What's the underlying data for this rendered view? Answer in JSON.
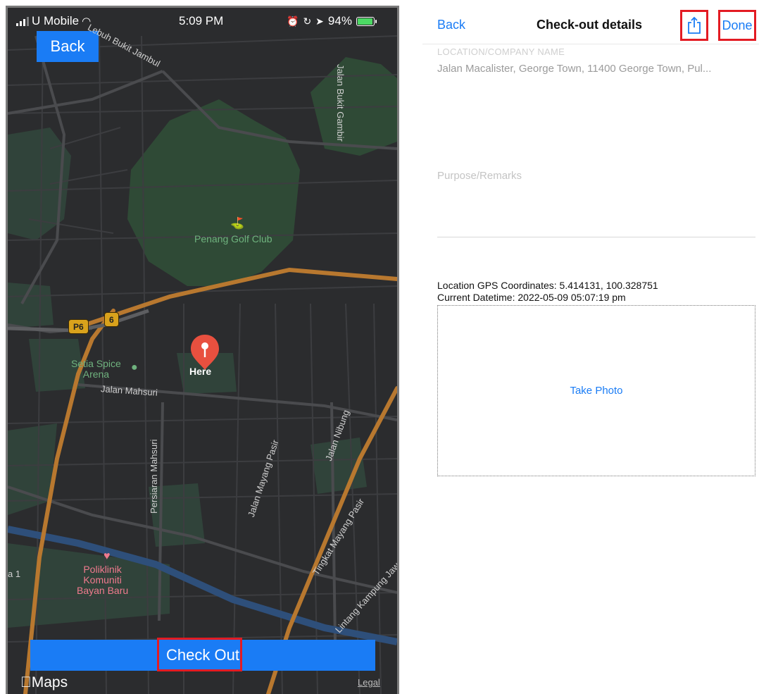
{
  "status_bar": {
    "carrier": "U Mobile",
    "time": "5:09 PM",
    "battery": "94%"
  },
  "map": {
    "back_label": "Back",
    "pin_label": "Here",
    "labels": {
      "golf": "Penang Golf Club",
      "arena": "Setia Spice\nArena",
      "jalan_mahsuri": "Jalan Mahsuri",
      "persiaran_mahsuri": "Persiaran Mahsuri",
      "jalan_mayang_pasir": "Jalan Mayang Pasir",
      "jalan_nibung": "Jalan Nibung",
      "tingkat_mayang_pasir": "Tingkat Mayang Pasir",
      "lintang_kampung_jawa": "Lintang Kampung Jawa",
      "bukit_jambul": "Lebuh Bukit Jambul",
      "bukit_gambir": "Jalan Bukit Gambir",
      "poliklinik": "Poliklinik\nKomuniti\nBayan Baru",
      "edge": "a 1"
    },
    "shields": {
      "p6": "P6",
      "six": "6"
    },
    "checkout_label": "Check Out",
    "maps_brand": "Maps",
    "legal": "Legal"
  },
  "form": {
    "back_label": "Back",
    "title": "Check-out details",
    "done_label": "Done",
    "location_placeholder": "LOCATION/COMPANY NAME",
    "location_value": "Jalan Macalister, George Town, 11400 George Town, Pul...",
    "purpose_placeholder": "Purpose/Remarks",
    "gps_text": "Location GPS Coordinates:  5.414131, 100.328751",
    "datetime_text": "Current Datetime:  2022-05-09 05:07:19 pm",
    "take_photo": "Take Photo"
  },
  "colors": {
    "accent": "#1a7cf5",
    "highlight": "#e31b23",
    "map_bg": "#2b2c2e",
    "road_major": "#b8782f",
    "pin": "#e8503f"
  }
}
